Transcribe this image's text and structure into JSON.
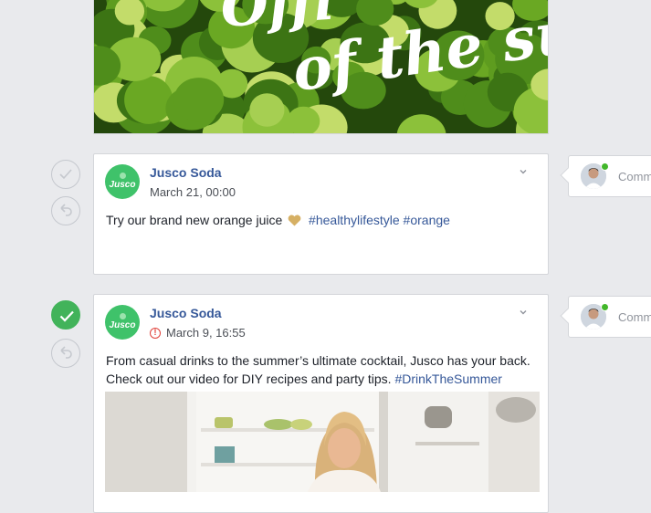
{
  "banner": {
    "overlay_text_line1": "Offi",
    "overlay_text_line2": "of the summ"
  },
  "posts": [
    {
      "brand": "Jusco Soda",
      "avatar_text": "Jusco",
      "date": "March 21,  00:00",
      "text_plain": "Try our brand new orange juice",
      "hashtags": "#healthylifestyle #orange",
      "status": "unapproved",
      "comment_placeholder": "Comment"
    },
    {
      "brand": "Jusco Soda",
      "avatar_text": "Jusco",
      "date": "March 9,  16:55",
      "text_line1": "From casual drinks to the summer’s ultimate cocktail, Jusco has your back.",
      "text_line2_plain": "Check out our video for DIY recipes and party tips.",
      "hashtag": "#DrinkTheSummer",
      "status": "approved",
      "comment_placeholder": "Comment"
    }
  ],
  "colors": {
    "link": "#365899",
    "brand_green": "#3fc26a",
    "approved_green": "#42b35a",
    "warning_red": "#e0413a"
  }
}
